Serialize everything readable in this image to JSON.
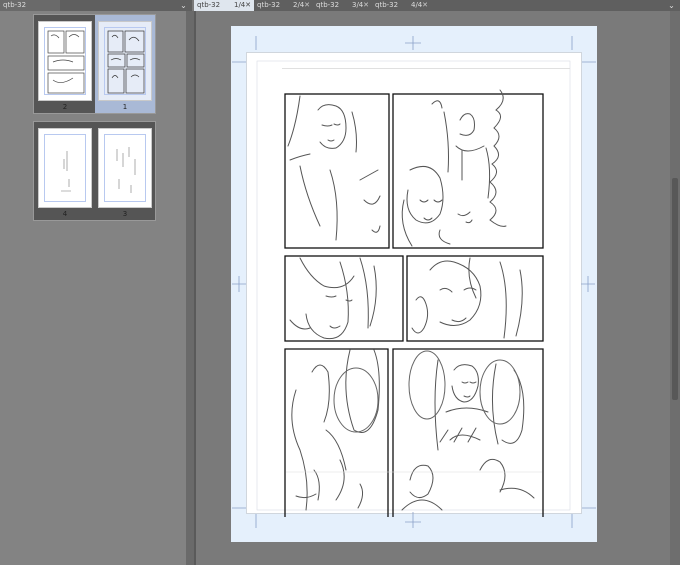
{
  "left_tabs": [
    {
      "label": "qtb-32"
    }
  ],
  "right_tabs": [
    {
      "label": "qtb-32",
      "page": "1/4",
      "active": true
    },
    {
      "label": "qtb-32",
      "page": "2/4",
      "active": false
    },
    {
      "label": "qtb-32",
      "page": "3/4",
      "active": false
    },
    {
      "label": "qtb-32",
      "page": "4/4",
      "active": false
    }
  ],
  "thumbnails": {
    "row1": [
      {
        "number": "2",
        "selected": false
      },
      {
        "number": "1",
        "selected": true
      }
    ],
    "row2": [
      {
        "number": "4",
        "selected": false
      },
      {
        "number": "3",
        "selected": false
      }
    ]
  },
  "colors": {
    "accent": "#dfe6ee",
    "canvas_bg": "#e5f0fc",
    "workspace": "#7a7a7a"
  }
}
